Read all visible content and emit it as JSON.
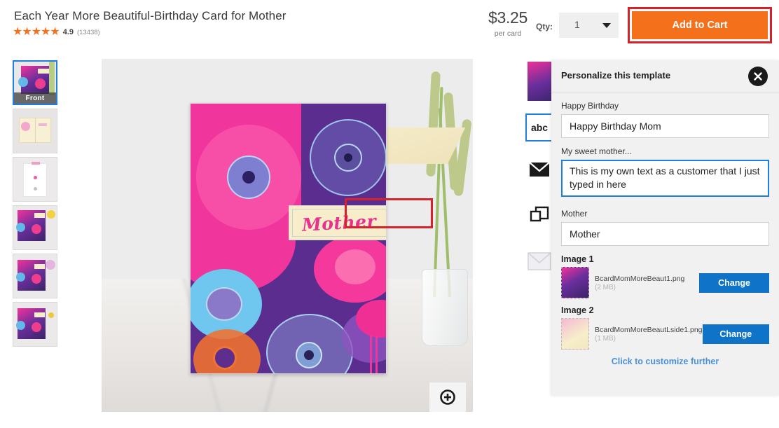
{
  "header": {
    "product_title": "Each Year More Beautiful-Birthday Card for Mother",
    "stars_glyph": "★★★★★",
    "rating_value": "4.9",
    "rating_count": "(13438)",
    "price": "$3.25",
    "price_unit": "per card",
    "qty_label": "Qty:",
    "qty_value": "1",
    "add_to_cart_label": "Add to Cart",
    "accent_orange": "#f4701b",
    "annotation_red": "#d6232b"
  },
  "thumbnails": [
    {
      "label": "Front",
      "selected": true
    },
    {
      "label": "",
      "selected": false
    },
    {
      "label": "",
      "selected": false
    },
    {
      "label": "",
      "selected": false
    },
    {
      "label": "",
      "selected": false
    },
    {
      "label": "",
      "selected": false
    }
  ],
  "preview": {
    "card_banner_text": "Mother",
    "zoom_icon": "zoom-in-icon"
  },
  "icon_rail": [
    {
      "icon": "card-thumbnail-icon",
      "label": "",
      "selected": false
    },
    {
      "icon": "text-abc-icon",
      "label": "abc",
      "selected": true
    },
    {
      "icon": "envelope-icon",
      "label": "",
      "selected": false
    },
    {
      "icon": "layers-icon",
      "label": "",
      "selected": false
    },
    {
      "icon": "envelope-outline-icon",
      "label": "",
      "selected": false
    }
  ],
  "panel": {
    "title": "Personalize this template",
    "close_icon": "close-icon",
    "fields": [
      {
        "label": "Happy Birthday",
        "value": "Happy Birthday Mom",
        "type": "input",
        "focused": false
      },
      {
        "label": "My sweet mother...",
        "value": "This is my own text as a customer that I just typed in here",
        "type": "textarea",
        "focused": true
      },
      {
        "label": "Mother",
        "value": "Mother",
        "type": "input",
        "focused": false
      }
    ],
    "images": [
      {
        "label": "Image 1",
        "filename": "BcardMomMoreBeaut1.png",
        "size": "(2 MB)",
        "button_label": "Change"
      },
      {
        "label": "Image 2",
        "filename": "BcardMomMoreBeautLside1.png",
        "size": "(1 MB)",
        "button_label": "Change"
      }
    ],
    "customize_link": "Click to customize further",
    "link_color": "#4a90d9",
    "button_blue": "#0f73c8",
    "focus_blue": "#1f7fe0"
  }
}
